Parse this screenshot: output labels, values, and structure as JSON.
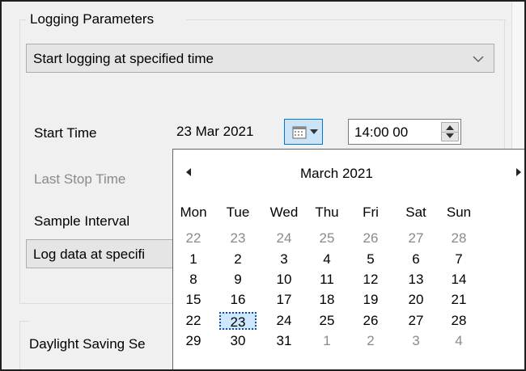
{
  "logging": {
    "group_title": "Logging Parameters",
    "mode_select": "Start logging at specified time",
    "start_time_label": "Start Time",
    "last_stop_label": "Last Stop Time",
    "sample_interval_label": "Sample Interval",
    "log_data_select": "Log data at specifi",
    "daylight_label": "Daylight Saving Se"
  },
  "date_picker": {
    "value": "23 Mar 2021",
    "time_value": "14:00 00"
  },
  "calendar": {
    "month": "March 2021",
    "weekdays": [
      "Mon",
      "Tue",
      "Wed",
      "Thu",
      "Fri",
      "Sat",
      "Sun"
    ],
    "weeks": [
      [
        "22",
        "23",
        "24",
        "25",
        "26",
        "27",
        "28"
      ],
      [
        "1",
        "2",
        "3",
        "4",
        "5",
        "6",
        "7"
      ],
      [
        "8",
        "9",
        "10",
        "11",
        "12",
        "13",
        "14"
      ],
      [
        "15",
        "16",
        "17",
        "18",
        "19",
        "20",
        "21"
      ],
      [
        "22",
        "23",
        "24",
        "25",
        "26",
        "27",
        "28"
      ],
      [
        "29",
        "30",
        "31",
        "1",
        "2",
        "3",
        "4"
      ]
    ]
  },
  "colors": {
    "accent": "#0078d7",
    "selected_bg": "#cde8ff",
    "disabled_text": "#8a8a8a"
  },
  "icons": {
    "calendar_button": "calendar-icon",
    "dropdown": "chevron-down-icon",
    "prev_month": "triangle-left-icon",
    "next_month": "triangle-right-icon"
  }
}
